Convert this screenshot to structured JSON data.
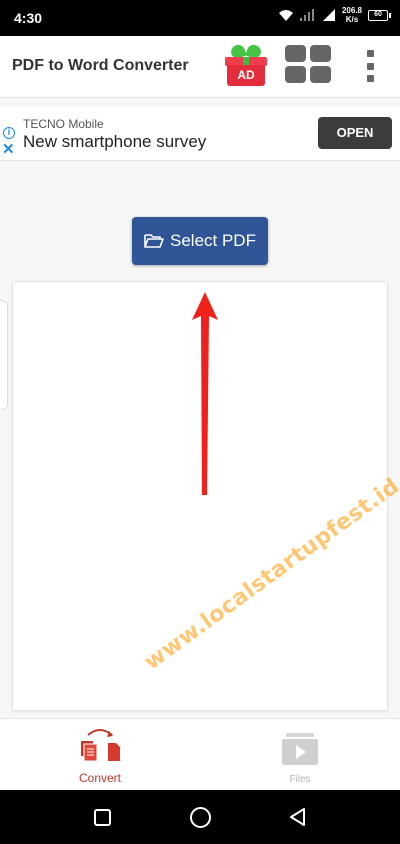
{
  "status_bar": {
    "time": "4:30",
    "network_speed_value": "206.8",
    "network_speed_unit": "K/s",
    "battery": "60"
  },
  "app_bar": {
    "title": "PDF to Word Converter",
    "ad_badge": "AD",
    "icons": [
      "gift-ad-icon",
      "grid-apps-icon",
      "more-vertical-icon"
    ]
  },
  "ad_banner": {
    "advertiser": "TECNO Mobile",
    "headline": "New smartphone survey",
    "cta": "OPEN",
    "info_glyph": "i",
    "close_glyph": "✕"
  },
  "main": {
    "select_pdf_label": "Select PDF"
  },
  "bottom_nav": {
    "items": [
      {
        "label": "Convert",
        "icon": "convert-icon",
        "active": true
      },
      {
        "label": "Files",
        "icon": "video-files-icon",
        "active": false
      }
    ]
  },
  "watermark": "www.localstartupfest.id",
  "colors": {
    "primary_button": "#2f5597",
    "accent_red": "#e32d3c",
    "arrow": "#f0201a",
    "active_nav": "#c0392b",
    "inactive_nav": "#b5b5b5",
    "watermark": "#ff9800"
  }
}
